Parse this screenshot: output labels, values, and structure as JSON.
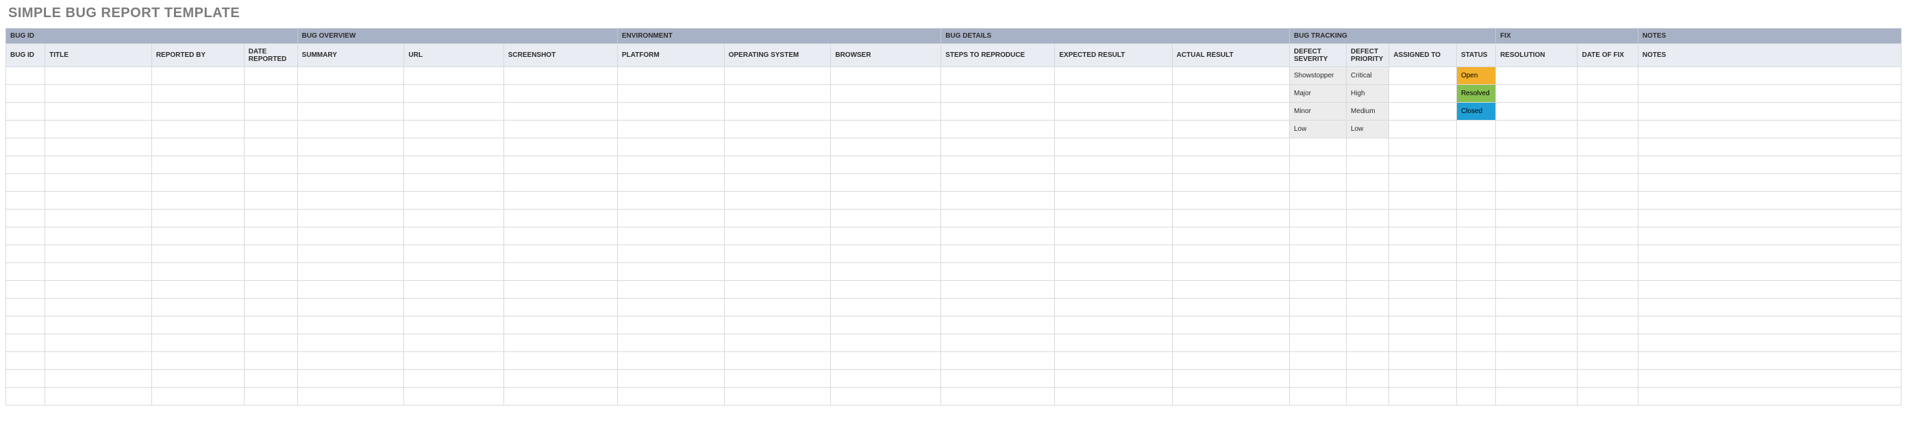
{
  "title": "SIMPLE BUG REPORT TEMPLATE",
  "groups": [
    {
      "label": "BUG ID",
      "span": 4
    },
    {
      "label": "BUG OVERVIEW",
      "span": 3
    },
    {
      "label": "ENVIRONMENT",
      "span": 3
    },
    {
      "label": "BUG DETAILS",
      "span": 3
    },
    {
      "label": "BUG TRACKING",
      "span": 4
    },
    {
      "label": "FIX",
      "span": 2
    },
    {
      "label": "NOTES",
      "span": 1
    }
  ],
  "columns": [
    "BUG ID",
    "TITLE",
    "REPORTED BY",
    "DATE REPORTED",
    "SUMMARY",
    "URL",
    "SCREENSHOT",
    "PLATFORM",
    "OPERATING SYSTEM",
    "BROWSER",
    "STEPS TO REPRODUCE",
    "EXPECTED RESULT",
    "ACTUAL RESULT",
    "DEFECT SEVERITY",
    "DEFECT PRIORITY",
    "ASSIGNED TO",
    "STATUS",
    "RESOLUTION",
    "DATE OF FIX",
    "NOTES"
  ],
  "severity_options": [
    "Showstopper",
    "Major",
    "Minor",
    "Low"
  ],
  "priority_options": [
    "Critical",
    "High",
    "Medium",
    "Low"
  ],
  "status_options": [
    "Open",
    "Resolved",
    "Closed"
  ],
  "colors": {
    "group_header_bg": "#a8b2c6",
    "col_header_bg": "#e9ecf2",
    "status_open": "#f3b02c",
    "status_resolved": "#86c04f",
    "status_closed": "#1f9fd6",
    "option_bg": "#ececec"
  },
  "empty_row_count": 19
}
